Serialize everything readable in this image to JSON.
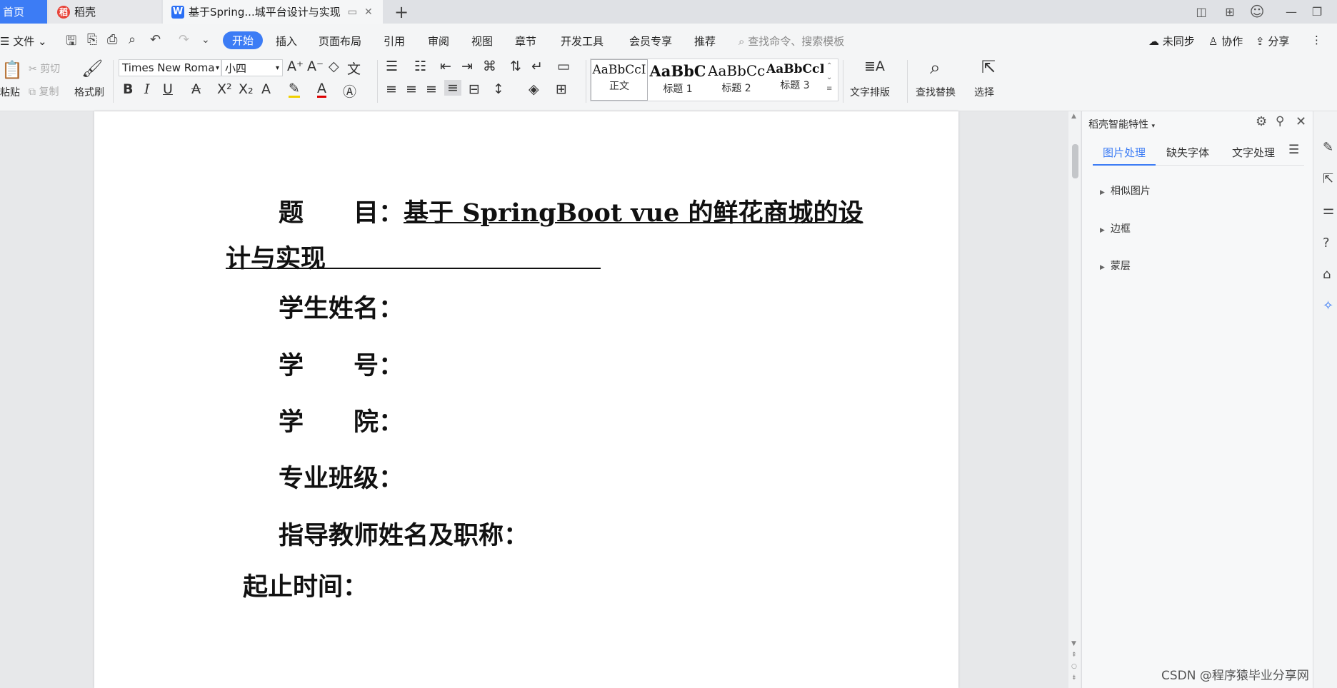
{
  "tabs": {
    "home": "首页",
    "daoke": "稻壳",
    "doc_title": "基于Spring...城平台设计与实现"
  },
  "menu": {
    "file": "文件",
    "start": "开始",
    "items": [
      "插入",
      "页面布局",
      "引用",
      "审阅",
      "视图",
      "章节",
      "开发工具",
      "会员专享",
      "推荐"
    ],
    "search_placeholder": "查找命令、搜索模板",
    "unsync": "未同步",
    "collab": "协作",
    "share": "分享"
  },
  "ribbon": {
    "paste": "粘贴",
    "cut": "剪切",
    "copy": "复制",
    "format_painter": "格式刷",
    "font_name": "Times New Roma",
    "font_size": "小四",
    "styles": [
      {
        "preview": "AaBbCcI",
        "name": "正文"
      },
      {
        "preview": "AaBbC",
        "name": "标题 1"
      },
      {
        "preview": "AaBbCc",
        "name": "标题 2"
      },
      {
        "preview": "AaBbCcI",
        "name": "标题 3"
      }
    ],
    "text_layout": "文字排版",
    "find_replace": "查找替换",
    "select": "选择"
  },
  "document": {
    "title_label": "题　　目：",
    "title_text": "基于 SpringBoot vue 的鲜花商城的设",
    "title_cont": "计与实现",
    "fields": [
      "学生姓名：",
      "学　　号：",
      "学　　院：",
      "专业班级：",
      "指导教师姓名及职称："
    ],
    "period": "起止时间："
  },
  "panel": {
    "title": "稻壳智能特性",
    "tabs": [
      "图片处理",
      "缺失字体",
      "文字处理"
    ],
    "active_tab": "图片处理",
    "items": [
      "相似图片",
      "边框",
      "蒙层"
    ]
  },
  "watermark": "CSDN @程序猿毕业分享网",
  "colors": {
    "accent": "#3c7cf5",
    "spell_error": "#d22"
  }
}
